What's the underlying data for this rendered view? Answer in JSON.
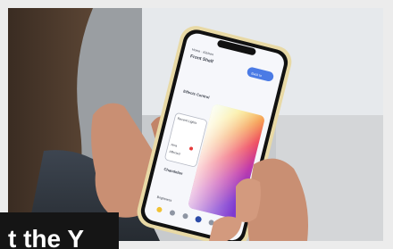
{
  "photo": {
    "subject": "hands holding a smartphone showing a smart lighting app",
    "colors": {
      "background": "#c4c7ca",
      "skin": "#c98f73",
      "phone_bezel": "#e8d9a5"
    }
  },
  "app_screen": {
    "breadcrumb": "Home · Kitchen",
    "title": "Front Shelf",
    "header_button": "Back to",
    "section_effects": "Effects Control",
    "recent_lights_label": "Recent Lights",
    "item_1_label": "Ama",
    "item_2_label": "Affected",
    "section_scenes": "Chandelier",
    "section_brightness": "Brightness",
    "nav_icons": [
      "bulb-icon",
      "home-icon",
      "clock-icon",
      "power-icon",
      "settings-icon",
      "more-icon"
    ]
  },
  "caption": {
    "text": "t the Y"
  }
}
